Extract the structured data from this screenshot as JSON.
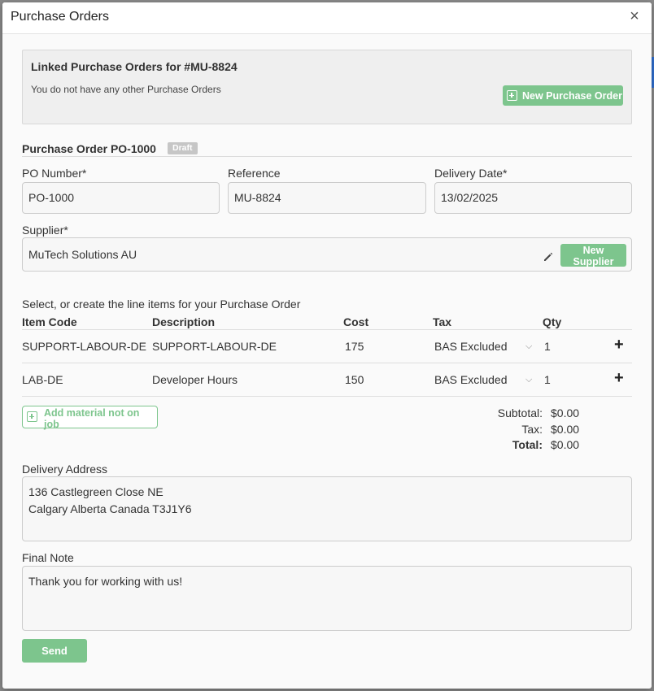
{
  "modal": {
    "title": "Purchase Orders",
    "close_glyph": "×"
  },
  "linked": {
    "title": "Linked Purchase Orders for #MU-8824",
    "subtitle": "You do not have any other Purchase Orders",
    "new_po_label": "New Purchase Order"
  },
  "po": {
    "title": "Purchase Order PO-1000",
    "status": "Draft",
    "po_number_label": "PO Number*",
    "po_number_value": "PO-1000",
    "reference_label": "Reference",
    "reference_value": "MU-8824",
    "delivery_date_label": "Delivery Date*",
    "delivery_date_value": "13/02/2025",
    "supplier_label": "Supplier*",
    "supplier_value": "MuTech Solutions AU",
    "new_supplier_label": "New Supplier"
  },
  "line_items": {
    "intro": "Select, or create the line items for your Purchase Order",
    "headers": [
      "Item Code",
      "Description",
      "Cost",
      "Tax",
      "Qty"
    ],
    "rows": [
      {
        "item_code": "SUPPORT-LABOUR-DE",
        "description": "SUPPORT-LABOUR-DE",
        "cost": "175",
        "tax": "BAS Excluded",
        "qty": "1"
      },
      {
        "item_code": "LAB-DE",
        "description": "Developer Hours",
        "cost": "150",
        "tax": "BAS Excluded",
        "qty": "1"
      }
    ],
    "add_material_label": "Add material not on job"
  },
  "totals": {
    "subtotal_label": "Subtotal:",
    "subtotal_value": "$0.00",
    "tax_label": "Tax:",
    "tax_value": "$0.00",
    "total_label": "Total:",
    "total_value": "$0.00"
  },
  "delivery": {
    "label": "Delivery Address",
    "line1": "136 Castlegreen Close NE",
    "line2": "Calgary Alberta Canada T3J1Y6"
  },
  "note": {
    "label": "Final Note",
    "value": "Thank you for working with us!"
  },
  "actions": {
    "send_label": "Send"
  },
  "colors": {
    "accent_green": "#7dc58d",
    "badge_grey": "#c6c6c6"
  }
}
